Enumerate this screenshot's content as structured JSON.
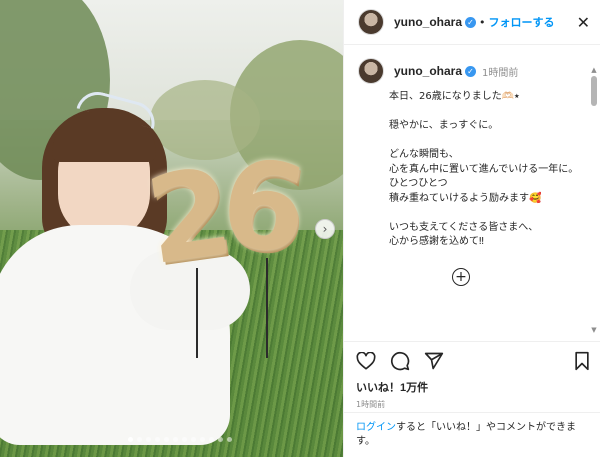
{
  "post": {
    "username": "yuno_ohara",
    "follow_label": "フォローする",
    "separator": "•",
    "close_glyph": "✕",
    "time_ago": "1時間前",
    "caption": "本日、26歳になりました🫶🏻⭑\n\n穏やかに、まっすぐに。\n\nどんな瞬間も、\n心を真ん中に置いて進んでいける一年に。\nひとつひとつ\n積み重ねていけるよう励みます🥰\n\nいつも支えてくださる皆さまへ、\n心から感謝を込めて‼︎",
    "likes": "いいね！1万件",
    "post_time": "1時間前"
  },
  "photo": {
    "balloon_digit_1": "2",
    "balloon_digit_2": "6",
    "carousel_next_glyph": "›",
    "slide_count": 12,
    "active_slide": 1
  },
  "login_prompt": {
    "link": "ログイン",
    "rest": "すると「いいね！」やコメントができます。"
  },
  "icons": {
    "verified": "verified-badge-icon",
    "like": "heart-icon",
    "comment": "comment-icon",
    "share": "share-icon",
    "save": "bookmark-icon",
    "add_comment": "plus-circle-icon",
    "close": "close-icon"
  },
  "colors": {
    "link_blue": "#0095f6",
    "verified_blue": "#3897f0",
    "text": "#262626",
    "muted": "#8e8e8e"
  }
}
